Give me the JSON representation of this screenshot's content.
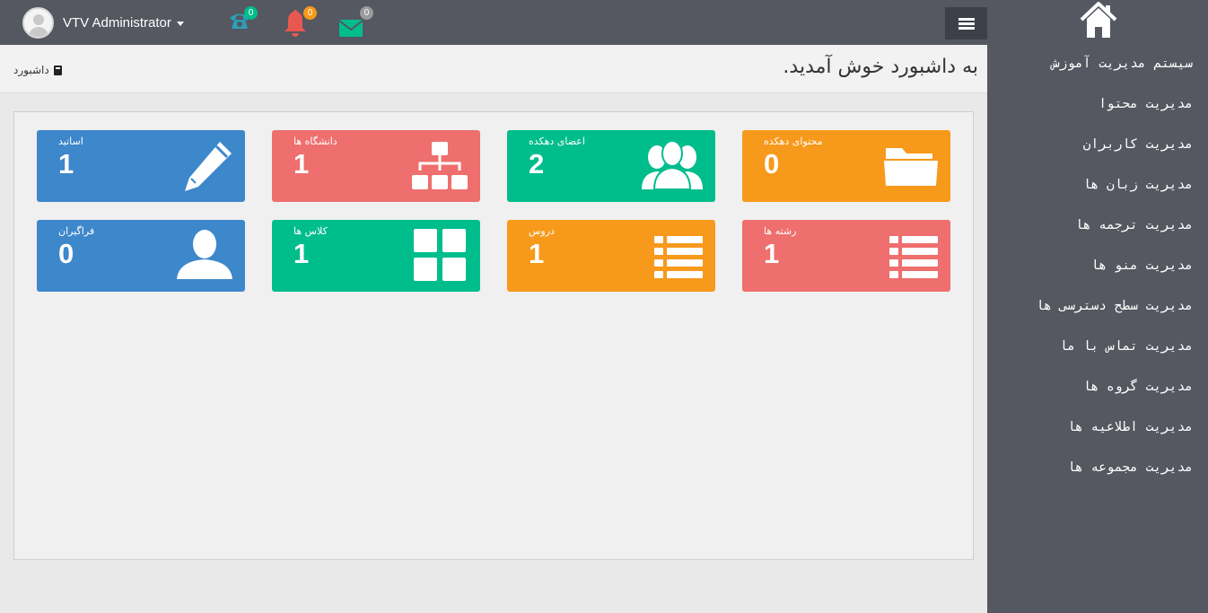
{
  "topbar": {
    "user_name": "VTV Administrator",
    "notifications": [
      {
        "name": "phone",
        "icon": "phone-icon",
        "count": "0",
        "icon_color": "#2d9fb8",
        "badge_color": "#00bd8c"
      },
      {
        "name": "alerts",
        "icon": "bell-icon",
        "count": "0",
        "icon_color": "#e9584f",
        "badge_color": "#f7991b"
      },
      {
        "name": "messages",
        "icon": "envelope-icon",
        "count": "0",
        "icon_color": "#00bd8c",
        "badge_color": "#9a9a9a"
      }
    ],
    "menu_toggle_icon": "hamburger-icon"
  },
  "sidebar": {
    "home_icon": "home-icon",
    "items": [
      {
        "label": "سیستم مدیریت آموزش"
      },
      {
        "label": "مدیریت محتوا"
      },
      {
        "label": "مدیریت کاربران"
      },
      {
        "label": "مدیریت زبان ها"
      },
      {
        "label": "مدیریت ترجمه ها"
      },
      {
        "label": "مدیریت منو ها"
      },
      {
        "label": "مدیریت سطح دسترسی ها"
      },
      {
        "label": "مدیریت تماس با ما"
      },
      {
        "label": "مدیریت گروه ها"
      },
      {
        "label": "مدیریت اطلاعیه ها"
      },
      {
        "label": "مدیریت مجموعه ها"
      }
    ]
  },
  "header": {
    "title": "به داشبورد خوش آمدید.",
    "breadcrumb": "داشبورد",
    "breadcrumb_icon": "dashboard-icon"
  },
  "tiles": [
    {
      "label": "اساتید",
      "value": "1",
      "icon": "pencil-icon",
      "color": "#3d87cb"
    },
    {
      "label": "دانشگاه ها",
      "value": "1",
      "icon": "sitemap-icon",
      "color": "#ee6f6d"
    },
    {
      "label": "اعضای دهکده",
      "value": "2",
      "icon": "users-icon",
      "color": "#00bd8c"
    },
    {
      "label": "محتوای دهکده",
      "value": "0",
      "icon": "folder-icon",
      "color": "#f7991b"
    },
    {
      "label": "فراگیران",
      "value": "0",
      "icon": "user-icon",
      "color": "#3d87cb"
    },
    {
      "label": "کلاس ها",
      "value": "1",
      "icon": "grid-icon",
      "color": "#00bd8c"
    },
    {
      "label": "دروس",
      "value": "1",
      "icon": "list-icon",
      "color": "#f7991b"
    },
    {
      "label": "رشته ها",
      "value": "1",
      "icon": "list-icon",
      "color": "#ee6f6d"
    }
  ]
}
